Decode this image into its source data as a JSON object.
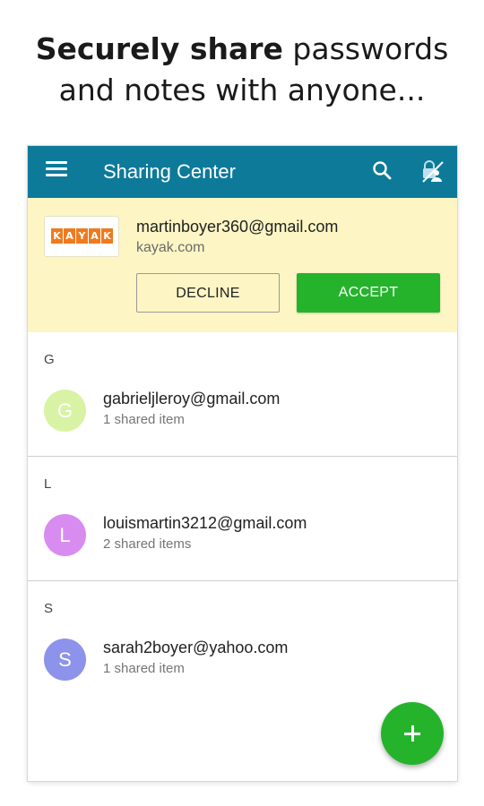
{
  "headline": {
    "bold": "Securely share",
    "rest": " passwords",
    "line2": "and notes with anyone..."
  },
  "app": {
    "title": "Sharing Center",
    "accent": "#0e7a99",
    "icons": [
      "menu-icon",
      "search-icon",
      "lock-share-icon"
    ]
  },
  "invite": {
    "logo_letters": [
      "K",
      "A",
      "Y",
      "A",
      "K"
    ],
    "email": "martinboyer360@gmail.com",
    "domain": "kayak.com",
    "decline_label": "DECLINE",
    "accept_label": "ACCEPT",
    "background": "#fdf5c4",
    "accept_color": "#25b32c"
  },
  "sections": [
    {
      "letter": "G",
      "email": "gabrieljleroy@gmail.com",
      "count": "1 shared item",
      "avatar_letter": "G",
      "avatar_color": "#d8f3a4"
    },
    {
      "letter": "L",
      "email": "louismartin3212@gmail.com",
      "count": "2 shared items",
      "avatar_letter": "L",
      "avatar_color": "#d98cf0"
    },
    {
      "letter": "S",
      "email": "sarah2boyer@yahoo.com",
      "count": "1 shared item",
      "avatar_letter": "S",
      "avatar_color": "#8d93ea"
    }
  ],
  "fab": {
    "icon": "plus-icon",
    "color": "#25b32c"
  }
}
